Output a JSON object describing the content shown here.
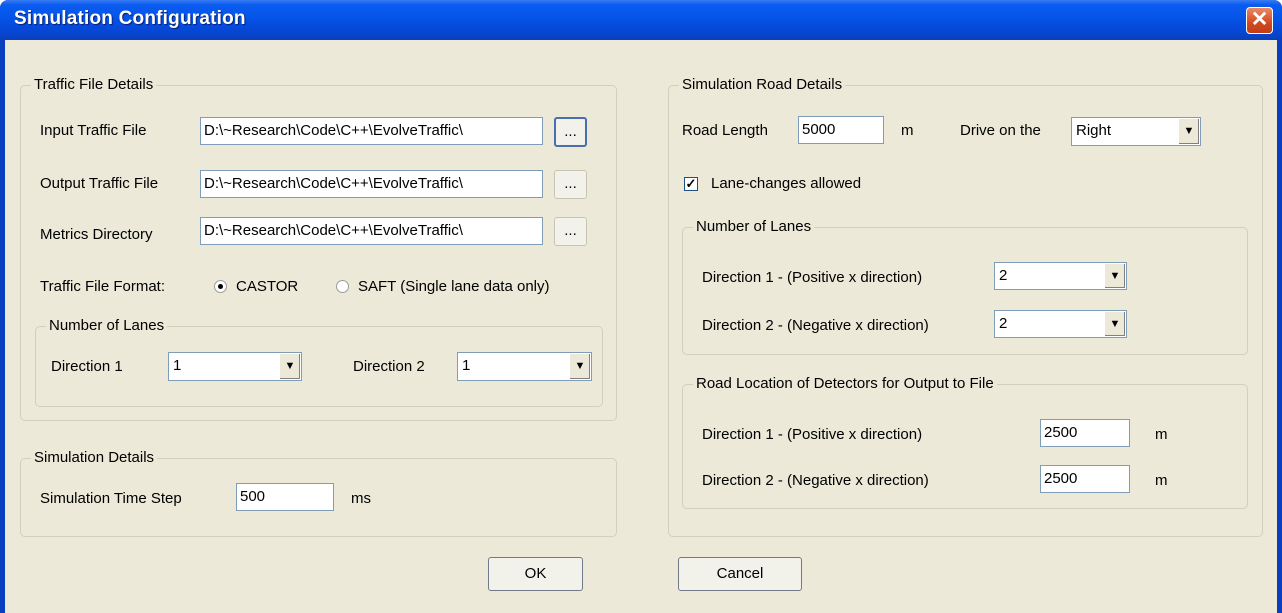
{
  "window": {
    "title": "Simulation Configuration",
    "close_glyph": "✕"
  },
  "traffic_file": {
    "legend": "Traffic File Details",
    "input_label": "Input Traffic File",
    "input_value": "D:\\~Research\\Code\\C++\\EvolveTraffic\\",
    "output_label": "Output Traffic File",
    "output_value": "D:\\~Research\\Code\\C++\\EvolveTraffic\\",
    "metrics_label": "Metrics Directory",
    "metrics_value": "D:\\~Research\\Code\\C++\\EvolveTraffic\\",
    "browse_label": "...",
    "format_label": "Traffic File Format:",
    "format_options": [
      "CASTOR",
      "SAFT (Single lane data only)"
    ],
    "format_selected": "CASTOR",
    "lanes": {
      "legend": "Number of Lanes",
      "dir1_label": "Direction 1",
      "dir1_value": "1",
      "dir2_label": "Direction 2",
      "dir2_value": "1"
    }
  },
  "simulation": {
    "legend": "Simulation Details",
    "timestep_label": "Simulation Time Step",
    "timestep_value": "500",
    "timestep_unit": "ms"
  },
  "road": {
    "legend": "Simulation Road Details",
    "length_label": "Road Length",
    "length_value": "5000",
    "length_unit": "m",
    "drive_label": "Drive on the",
    "drive_value": "Right",
    "lane_change_label": "Lane-changes allowed",
    "lane_change_checked": true,
    "check_glyph": "✓",
    "lanes": {
      "legend": "Number of Lanes",
      "dir1_label": "Direction 1 - (Positive x direction)",
      "dir1_value": "2",
      "dir2_label": "Direction 2 - (Negative x direction)",
      "dir2_value": "2"
    },
    "detectors": {
      "legend": "Road Location of Detectors for Output to File",
      "dir1_label": "Direction 1 - (Positive x direction)",
      "dir1_value": "2500",
      "dir2_label": "Direction 2 - (Negative x direction)",
      "dir2_value": "2500",
      "unit": "m"
    }
  },
  "buttons": {
    "ok": "OK",
    "cancel": "Cancel"
  },
  "icons": {
    "dropdown": "chevron-down-icon",
    "close": "close-icon"
  }
}
